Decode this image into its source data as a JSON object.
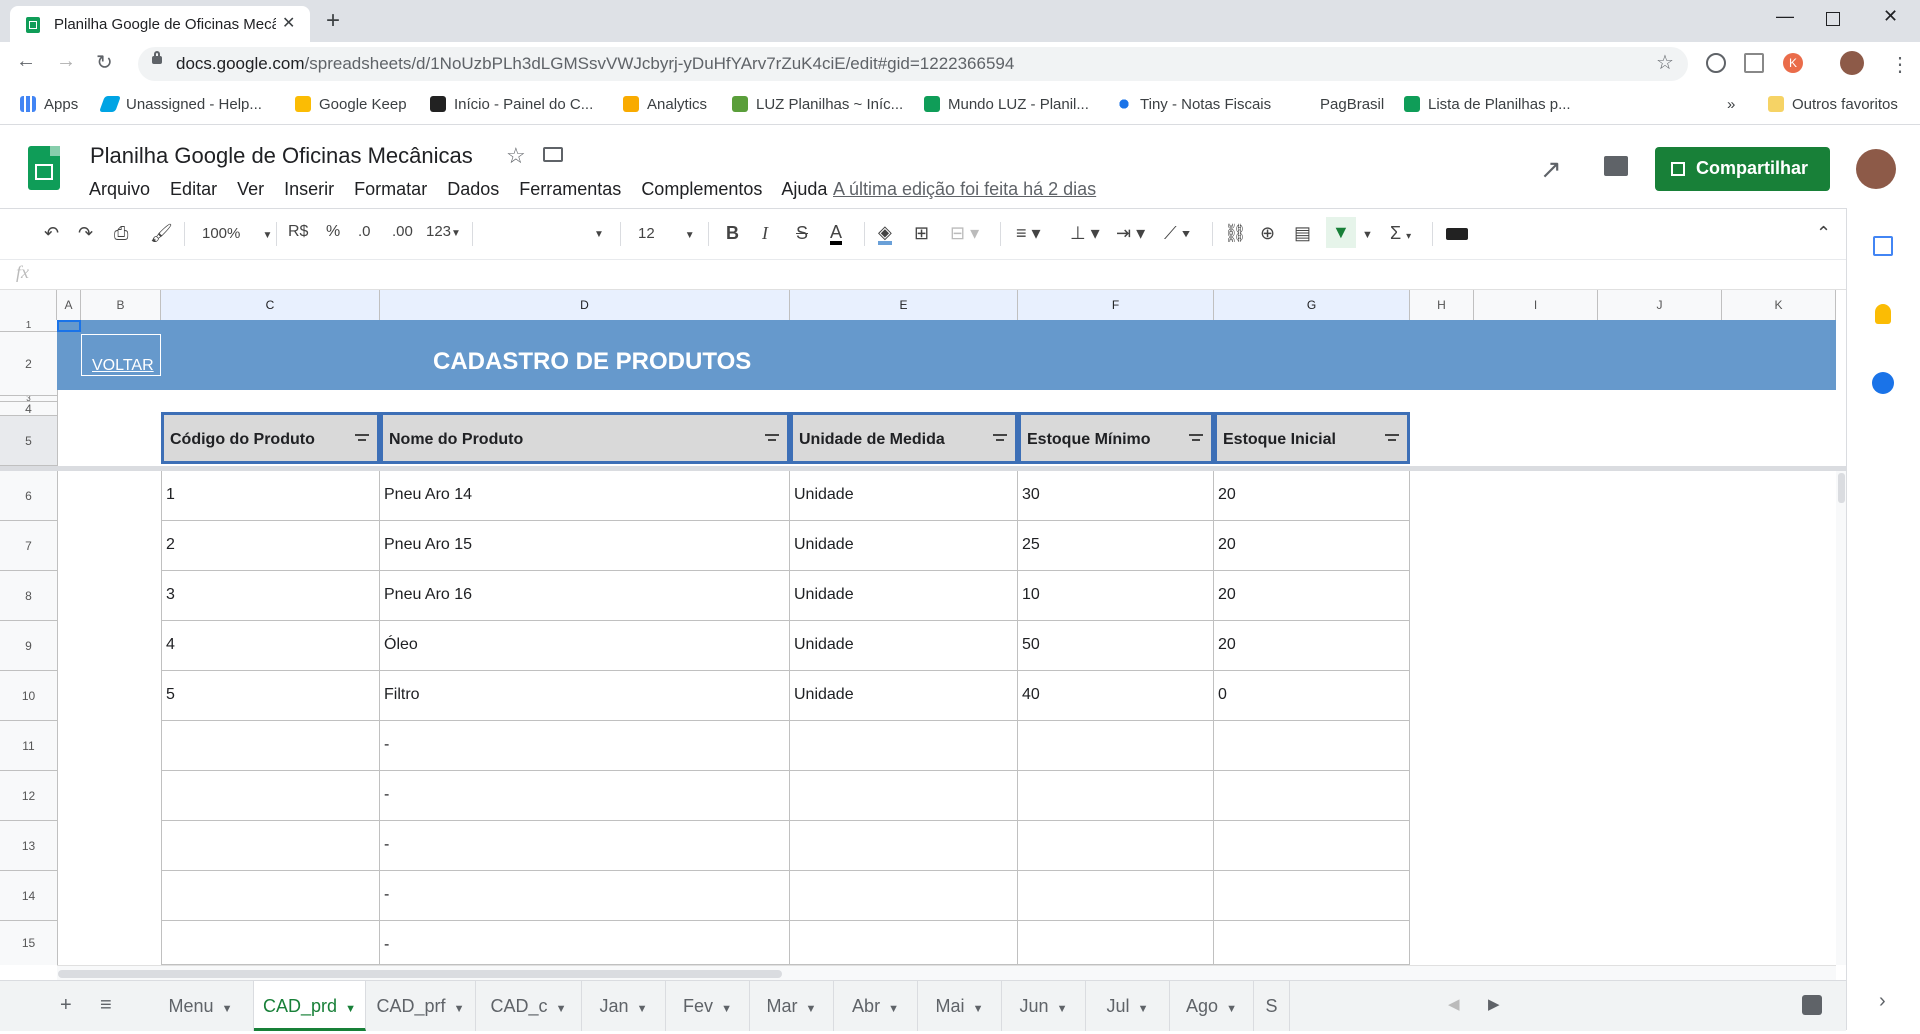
{
  "browser": {
    "tab_title": "Planilha Google de Oficinas Mecânicas",
    "url_host": "docs.google.com",
    "url_path": "/spreadsheets/d/1NoUzbPLh3dLGMSsvVWJcbyrj-yDuHfYArv7rZuK4ciE/edit#gid=1222366594",
    "bookmarks": [
      "Apps",
      "Unassigned - Help...",
      "Google Keep",
      "Início - Painel do C...",
      "Analytics",
      "LUZ Planilhas ~ Iníc...",
      "Mundo LUZ - Planil...",
      "Tiny - Notas Fiscais",
      "PagBrasil",
      "Lista de Planilhas p...",
      "Outros favoritos"
    ],
    "ext_badge": "K"
  },
  "doc": {
    "title": "Planilha Google de Oficinas Mecânicas",
    "menu": [
      "Arquivo",
      "Editar",
      "Ver",
      "Inserir",
      "Formatar",
      "Dados",
      "Ferramentas",
      "Complementos",
      "Ajuda"
    ],
    "last_edit": "A última edição foi feita há 2 dias",
    "share_label": "Compartilhar"
  },
  "toolbar": {
    "zoom": "100%",
    "currency": "R$",
    "percent": "%",
    "dec_less": ".0",
    "dec_more": ".00",
    "format_more": "123",
    "font_size": "12",
    "bold": "B",
    "italic": "I",
    "strike": "S",
    "text_color": "A",
    "sum": "Σ"
  },
  "grid": {
    "columns": [
      "A",
      "B",
      "C",
      "D",
      "E",
      "F",
      "G",
      "H",
      "I",
      "J",
      "K"
    ],
    "rows": [
      "1",
      "2",
      "3",
      "4",
      "5",
      "6",
      "7",
      "8",
      "9",
      "10",
      "11",
      "12",
      "13",
      "14",
      "15"
    ],
    "voltar": "VOLTAR",
    "banner_title": "CADASTRO DE PRODUTOS",
    "headers": [
      "Código do Produto",
      "Nome do Produto",
      "Unidade de Medida",
      "Estoque Mínimo",
      "Estoque Inicial"
    ],
    "data": [
      [
        "1",
        "Pneu Aro 14",
        "Unidade",
        "30",
        "20"
      ],
      [
        "2",
        "Pneu Aro 15",
        "Unidade",
        "25",
        "20"
      ],
      [
        "3",
        "Pneu Aro 16",
        "Unidade",
        "10",
        "20"
      ],
      [
        "4",
        "Óleo",
        "Unidade",
        "50",
        "20"
      ],
      [
        "5",
        "Filtro",
        "Unidade",
        "40",
        "0"
      ],
      [
        "",
        "-",
        "",
        "",
        ""
      ],
      [
        "",
        "-",
        "",
        "",
        ""
      ],
      [
        "",
        "-",
        "",
        "",
        ""
      ],
      [
        "",
        "-",
        "",
        "",
        ""
      ],
      [
        "",
        "-",
        "",
        "",
        ""
      ]
    ]
  },
  "sheets": [
    "Menu",
    "CAD_prd",
    "CAD_prf",
    "CAD_c",
    "Jan",
    "Fev",
    "Mar",
    "Abr",
    "Mai",
    "Jun",
    "Jul",
    "Ago",
    "S"
  ],
  "active_sheet": "CAD_prd",
  "colors": {
    "accent": "#188038",
    "banner": "#6699cc",
    "header_border": "#3d6fb6"
  }
}
